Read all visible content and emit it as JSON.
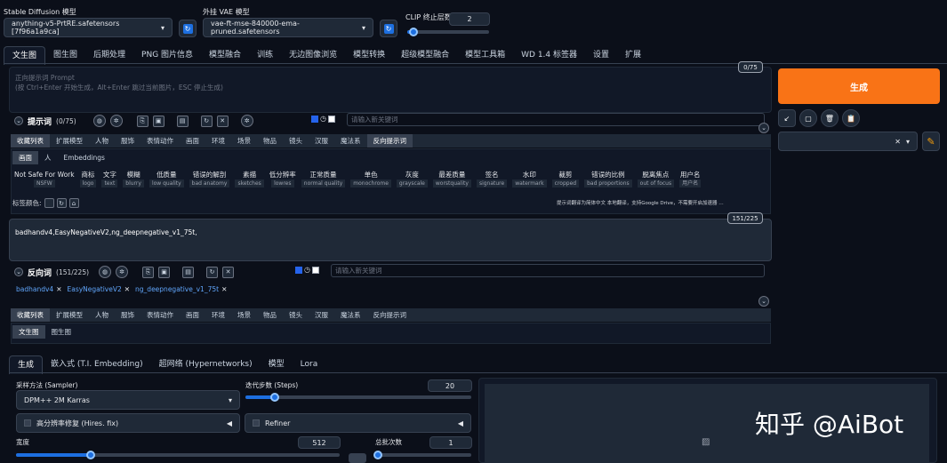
{
  "header": {
    "model_label": "Stable Diffusion 模型",
    "model_value": "anything-v5-PrtRE.safetensors [7f96a1a9ca]",
    "vae_label": "外挂 VAE 模型",
    "vae_value": "vae-ft-mse-840000-ema-pruned.safetensors",
    "clip_label": "CLIP 终止层数",
    "clip_value": "2",
    "clip_level": 0.08,
    "refresh_glyph": "↻"
  },
  "tabs": [
    "文生图",
    "图生图",
    "后期处理",
    "PNG 图片信息",
    "模型融合",
    "训练",
    "无边图像浏览",
    "模型转换",
    "超级模型融合",
    "模型工具箱",
    "WD 1.4 标签器",
    "设置",
    "扩展"
  ],
  "prompt": {
    "token_count": "0/75",
    "placeholder": "正向提示词 Prompt\n(按 Ctrl+Enter 开始生成，Alt+Enter 跳过当前图片，ESC 停止生成)",
    "title": "提示词",
    "count": "(0/75)",
    "keyword_placeholder": "请输入新关键词"
  },
  "generate": {
    "button_label": "生成",
    "tool_glyphs": [
      "↙",
      "▢",
      "🗑",
      "📋"
    ],
    "style_clear": "✕",
    "style_arrow": "▾",
    "edit_glyph": "✎"
  },
  "category_tabs": [
    "收藏列表",
    "扩展模型",
    "人物",
    "服饰",
    "表情动作",
    "画面",
    "环境",
    "场景",
    "物品",
    "镜头",
    "汉服",
    "魔法系",
    "反向提示词"
  ],
  "subtabs": [
    "画面",
    "人",
    "Embeddings"
  ],
  "keywords": [
    {
      "cn": "Not Safe For Work",
      "en": "NSFW"
    },
    {
      "cn": "商标",
      "en": "logo"
    },
    {
      "cn": "文字",
      "en": "text"
    },
    {
      "cn": "模糊",
      "en": "blurry"
    },
    {
      "cn": "低质量",
      "en": "low quality"
    },
    {
      "cn": "错误的解剖",
      "en": "bad anatomy"
    },
    {
      "cn": "素描",
      "en": "sketches"
    },
    {
      "cn": "低分辨率",
      "en": "lowres"
    },
    {
      "cn": "正常质量",
      "en": "normal quality"
    },
    {
      "cn": "单色",
      "en": "monochrome"
    },
    {
      "cn": "灰度",
      "en": "grayscale"
    },
    {
      "cn": "最差质量",
      "en": "worstquality"
    },
    {
      "cn": "签名",
      "en": "signature"
    },
    {
      "cn": "水印",
      "en": "watermark"
    },
    {
      "cn": "裁剪",
      "en": "cropped"
    },
    {
      "cn": "错误的比例",
      "en": "bad proportions"
    },
    {
      "cn": "脱离焦点",
      "en": "out of focus"
    },
    {
      "cn": "用户名",
      "en": "用户名"
    }
  ],
  "tag_color_label": "标签颜色:",
  "notice": "提示词翻译为简体中文 本地翻译，支持Google Drive，不需要开启加速器 …",
  "negative": {
    "token_count": "151/225",
    "text": "badhandv4,EasyNegativeV2,ng_deepnegative_v1_75t,",
    "title": "反向词",
    "count": "(151/225)",
    "keyword_placeholder": "请输入新关键词",
    "chips": [
      "badhandv4",
      "EasyNegativeV2",
      "ng_deepnegative_v1_75t"
    ]
  },
  "bottom_subtabs": [
    "文生图",
    "图生图"
  ],
  "settings_tabs": [
    "生成",
    "嵌入式 (T.I. Embedding)",
    "超网络 (Hypernetworks)",
    "模型",
    "Lora"
  ],
  "sampler": {
    "label": "采样方法 (Sampler)",
    "value": "DPM++ 2M Karras"
  },
  "steps": {
    "label": "迭代步数 (Steps)",
    "value": "20",
    "level": 0.13
  },
  "hires": {
    "label": "高分辨率修复 (Hires. fix)"
  },
  "refiner": {
    "label": "Refiner"
  },
  "width": {
    "label": "宽度",
    "value": "512",
    "level": 0.23
  },
  "batch": {
    "label": "总批次数",
    "value": "1",
    "level": 0.01
  },
  "watermark": "知乎 @AiBot",
  "colors": {
    "accent": "#1d6fe0",
    "generate": "#f97316",
    "chip": "#60a5fa"
  }
}
